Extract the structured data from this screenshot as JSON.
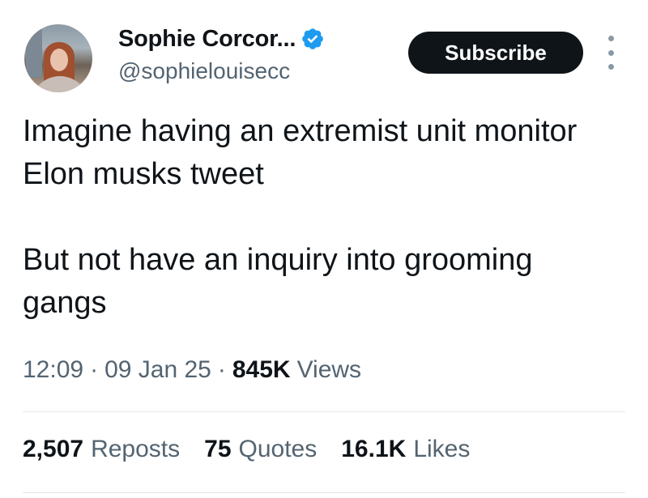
{
  "author": {
    "display_name": "Sophie Corcor...",
    "handle": "@sophielouisecc",
    "verified_icon": "verified-badge-icon",
    "verified_color": "#1d9bf0"
  },
  "actions": {
    "subscribe_label": "Subscribe",
    "more_icon": "more-options-icon"
  },
  "tweet": {
    "paragraphs": [
      "Imagine having an extremist unit monitor Elon musks tweet",
      "But not have an inquiry into grooming gangs"
    ],
    "time": "12:09",
    "date": "09 Jan 25",
    "views_count": "845K",
    "views_label": "Views",
    "separator": "·"
  },
  "stats": [
    {
      "count": "2,507",
      "label": "Reposts"
    },
    {
      "count": "75",
      "label": "Quotes"
    },
    {
      "count": "16.1K",
      "label": "Likes"
    }
  ],
  "colors": {
    "text_primary": "#0f1419",
    "text_secondary": "#536471",
    "button_bg": "#0f1419",
    "divider": "#e3e7ea"
  }
}
